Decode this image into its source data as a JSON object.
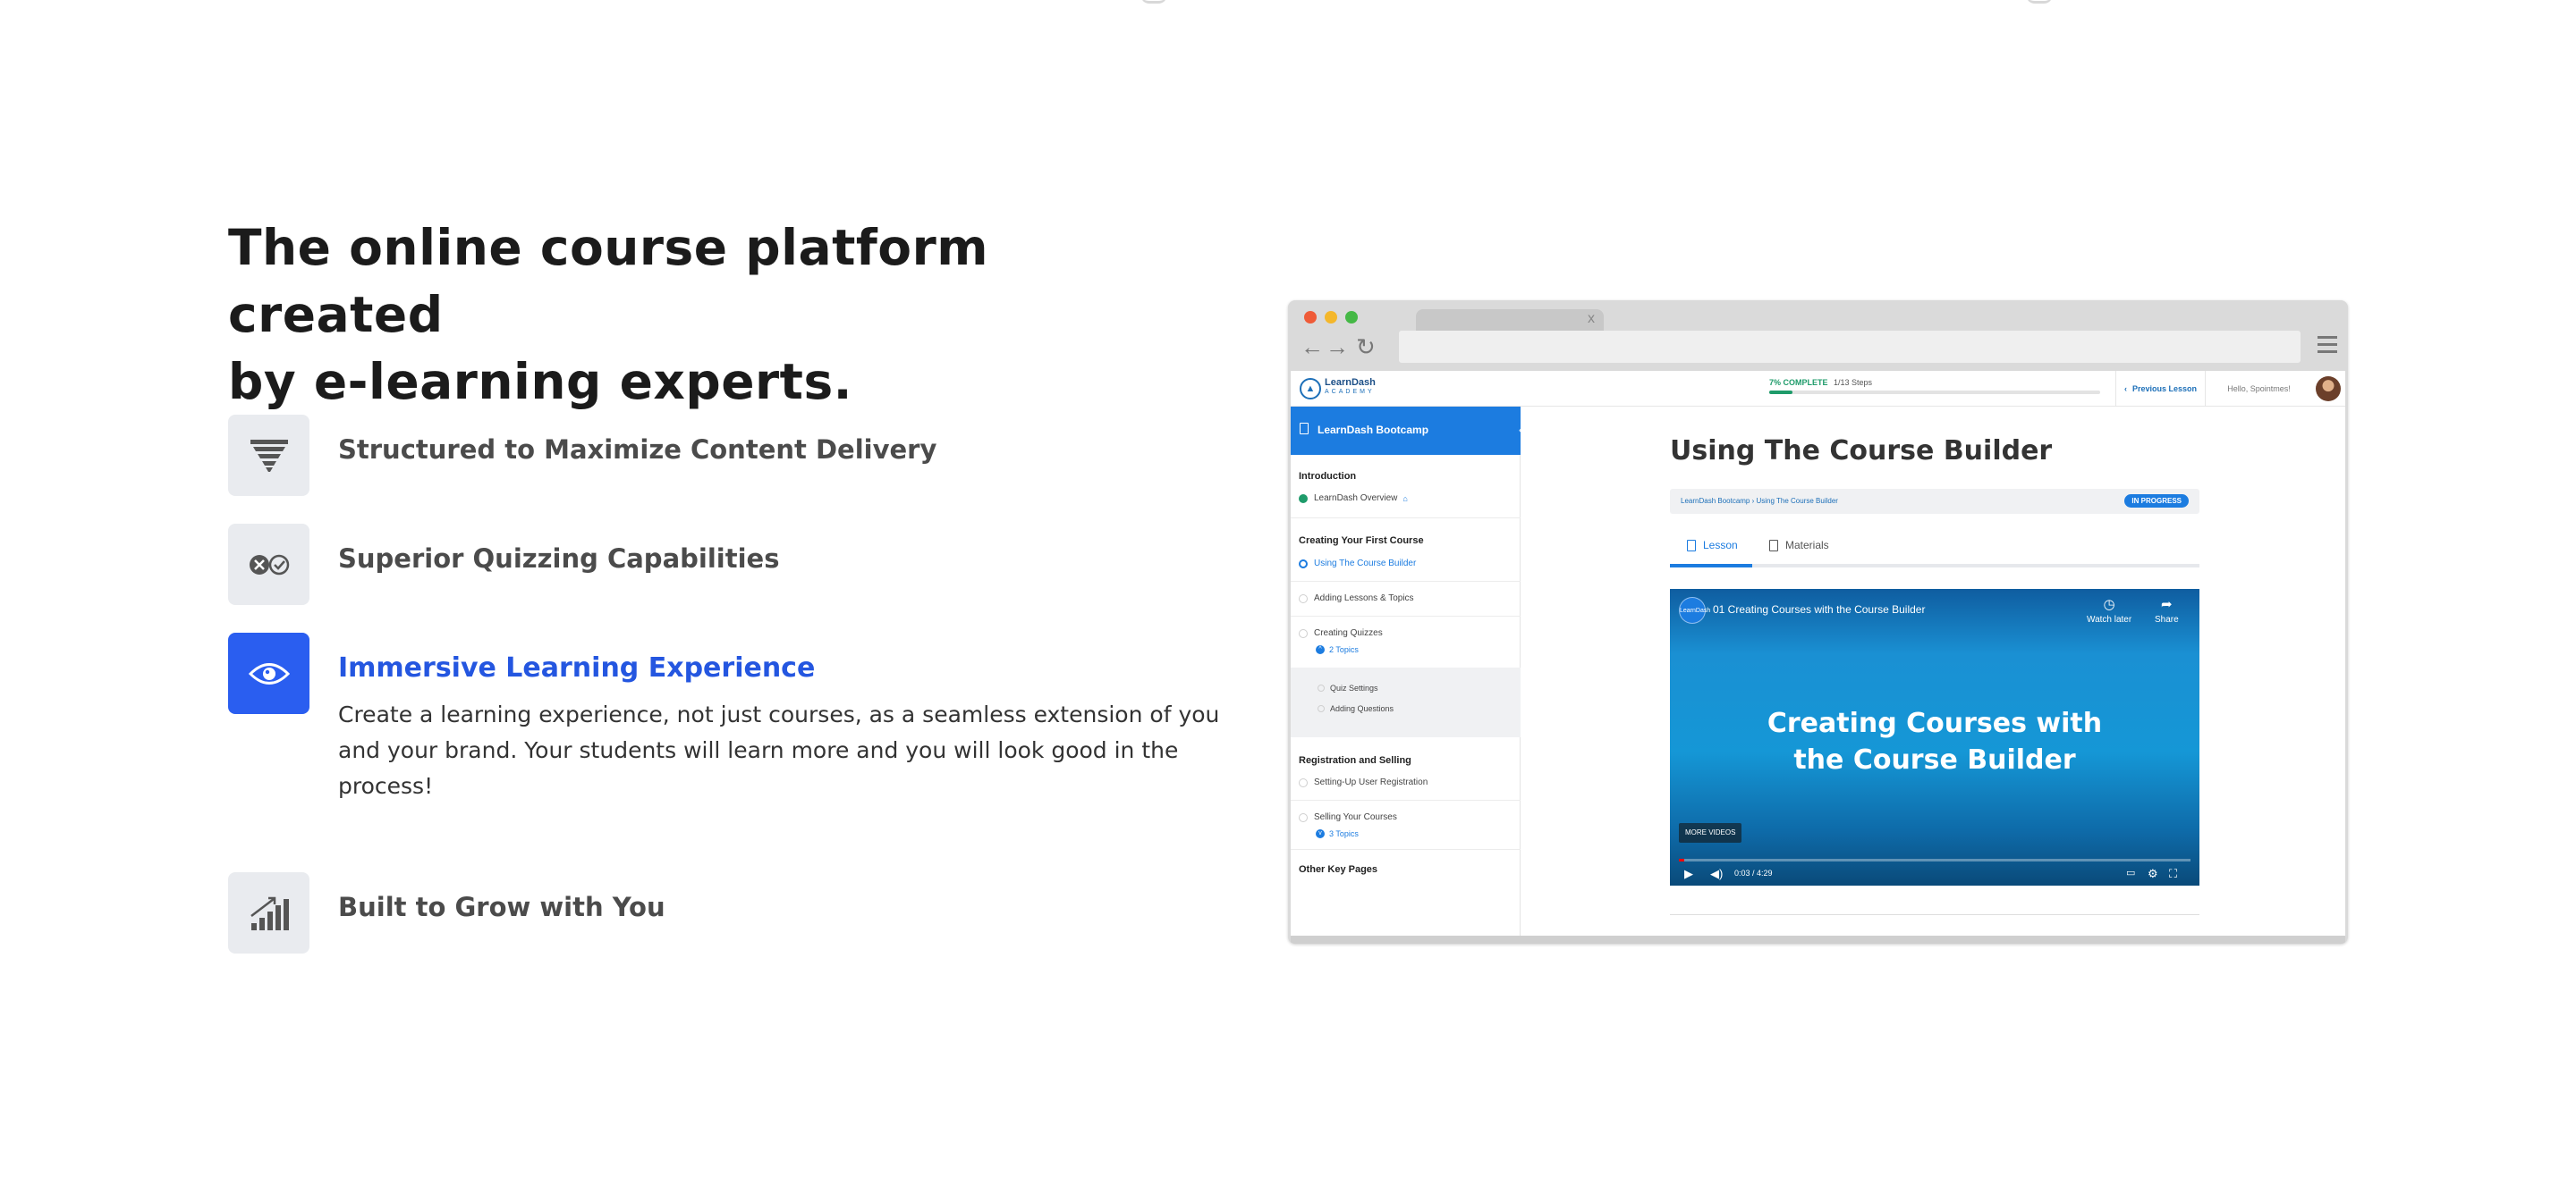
{
  "hero": {
    "title_line1": "The online course platform created",
    "title_line2": "by e-learning experts."
  },
  "features": [
    {
      "title": "Structured to Maximize Content Delivery",
      "icon": "funnel-icon",
      "active": false
    },
    {
      "title": "Superior Quizzing Capabilities",
      "icon": "quiz-check-icon",
      "active": false
    },
    {
      "title": "Immersive Learning Experience",
      "icon": "eye-icon",
      "active": true,
      "description": "Create a learning experience, not just courses, as a seamless extension of you and your brand. Your students will learn more and you will look good in the process!"
    },
    {
      "title": "Built to Grow with You",
      "icon": "growth-chart-icon",
      "active": false
    }
  ],
  "colors": {
    "accent": "#2a5ef0",
    "accent_text": "#2456e0",
    "icon_bg": "#e9ebef",
    "ld_blue": "#1c7ce0",
    "ld_green": "#1e9b6a"
  },
  "browser": {
    "tab_close": "x",
    "app": {
      "logo_title": "LearnDash",
      "logo_sub": "ACADEMY",
      "progress_label": "7% COMPLETE",
      "progress_steps": "1/13 Steps",
      "progress_percent": 7,
      "prev_lesson": "Previous Lesson",
      "greeting": "Hello, Spointmes!",
      "course_title": "LearnDash Bootcamp",
      "sections": [
        {
          "label": "Introduction"
        },
        {
          "label": "Creating Your First Course"
        },
        {
          "label": "Registration and Selling"
        },
        {
          "label": "Other Key Pages"
        }
      ],
      "items": {
        "overview": "LearnDash Overview",
        "course_builder": "Using The Course Builder",
        "lessons_topics": "Adding Lessons & Topics",
        "quizzes": "Creating Quizzes",
        "quizzes_topics": "2 Topics",
        "quiz_settings": "Quiz Settings",
        "adding_questions": "Adding Questions",
        "user_registration": "Setting-Up User Registration",
        "selling": "Selling Your Courses",
        "selling_topics": "3 Topics"
      },
      "lesson_title": "Using The Course Builder",
      "breadcrumb": "LearnDash Bootcamp › Using The Course Builder",
      "status_badge": "IN PROGRESS",
      "tabs": {
        "lesson": "Lesson",
        "materials": "Materials"
      },
      "video": {
        "title": "01 Creating Courses with the Course Builder",
        "logo": "LearnDash",
        "watch_later": "Watch later",
        "share": "Share",
        "main_line1": "Creating Courses with",
        "main_line2": "the Course Builder",
        "more_videos": "MORE VIDEOS",
        "time": "0:03 / 4:29",
        "progress_fraction": 0.011
      }
    }
  }
}
